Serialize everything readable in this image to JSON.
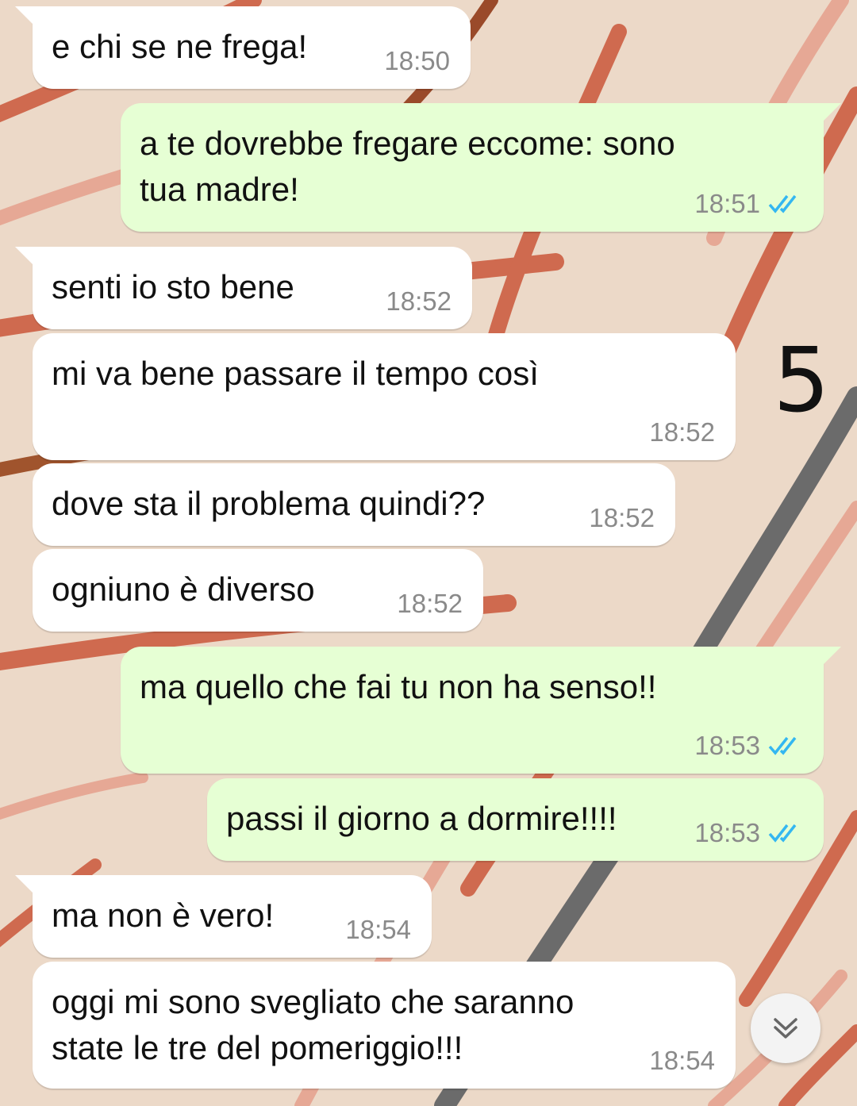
{
  "messages": [
    {
      "dir": "in",
      "text": "e chi se ne frega!",
      "time": "18:50",
      "read": false
    },
    {
      "dir": "out",
      "text": "a te dovrebbe fregare eccome: sono\ntua madre!",
      "time": "18:51",
      "read": true
    },
    {
      "dir": "in",
      "text": "senti io sto bene",
      "time": "18:52",
      "read": false
    },
    {
      "dir": "in",
      "text": "mi va bene passare il tempo così",
      "time": "18:52",
      "read": false
    },
    {
      "dir": "in",
      "text": "dove sta il problema quindi??",
      "time": "18:52",
      "read": false
    },
    {
      "dir": "in",
      "text": "ogniuno è diverso",
      "time": "18:52",
      "read": false
    },
    {
      "dir": "out",
      "text": "ma quello che fai tu non ha senso!!",
      "time": "18:53",
      "read": true
    },
    {
      "dir": "out",
      "text": "passi il giorno a dormire!!!!",
      "time": "18:53",
      "read": true
    },
    {
      "dir": "in",
      "text": "ma non è vero!",
      "time": "18:54",
      "read": false
    },
    {
      "dir": "in",
      "text": "oggi mi sono svegliato che saranno\nstate le tre del pomeriggio!!!",
      "time": "18:54",
      "read": false
    }
  ],
  "annotation": {
    "text": "5"
  },
  "icons": {
    "read_receipt": "double-check-icon",
    "scroll_down": "chevron-double-down-icon"
  },
  "colors": {
    "incoming_bubble": "#ffffff",
    "outgoing_bubble": "#e6ffd4",
    "read_tick": "#34b7f1",
    "timestamp": "#8a8a8a",
    "wallpaper": "#ecd9c8"
  }
}
